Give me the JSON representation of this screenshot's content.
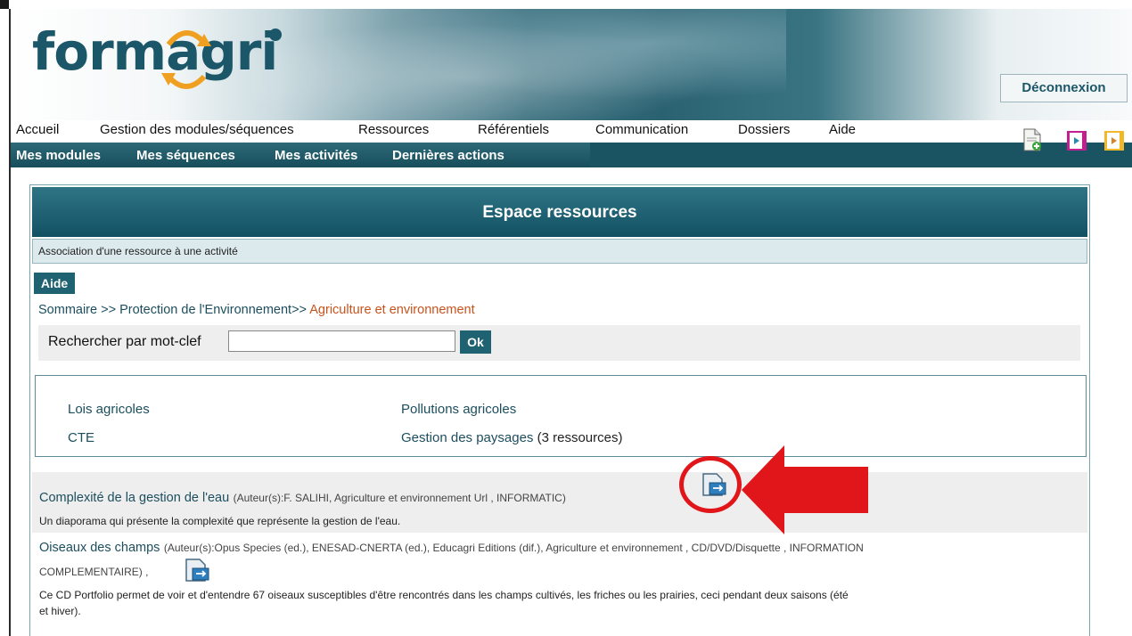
{
  "header": {
    "logo_text": "formagri",
    "logout_label": "Déconnexion",
    "icons": [
      "document-add-icon",
      "book-icon",
      "book-open-icon"
    ]
  },
  "mainnav": {
    "items": [
      "Accueil",
      "Gestion des modules/séquences",
      "Ressources",
      "Référentiels",
      "Communication",
      "Dossiers",
      "Aide"
    ]
  },
  "subnav": {
    "items": [
      "Mes modules",
      "Mes séquences",
      "Mes activités",
      "Dernières actions"
    ]
  },
  "panel": {
    "title": "Espace ressources",
    "assoc_text": "Association d'une ressource à une activité",
    "aide_label": "Aide"
  },
  "breadcrumb": {
    "root": "Sommaire",
    "sep": ">>",
    "level1": "Protection de l'Environnement",
    "current": "Agriculture et environnement"
  },
  "search": {
    "label": "Rechercher par mot-clef",
    "value": "",
    "ok_label": "Ok"
  },
  "categories": {
    "col1": [
      "Lois agricoles",
      "CTE"
    ],
    "col2": [
      "Pollutions agricoles",
      "Gestion des paysages"
    ],
    "count_text": "(3 ressources)"
  },
  "resources": [
    {
      "title": "Complexité de la gestion de l'eau",
      "meta": "(Auteur(s):F. SALIHI, Agriculture et environnement Url , INFORMATIC",
      "meta_tail": ")",
      "desc": "Un diaporama qui présente la complexité que représente la gestion de l'eau."
    },
    {
      "title": "Oiseaux des champs",
      "meta_line1": "(Auteur(s):Opus Species (ed.), ENESAD-CNERTA (ed.), Educagri Editions (dif.), Agriculture et environnement , CD/DVD/Disquette , INFORMATION",
      "meta_line2": "COMPLEMENTAIRE) ,",
      "desc_line1": "Ce CD Portfolio permet de voir et d'entendre 67 oiseaux susceptibles d'être rencontrés dans les champs cultivés, les friches ou les prairies, ceci pendant deux saisons (été",
      "desc_line2": "et hiver)."
    }
  ],
  "annotation": {
    "color": "#e0161b"
  }
}
